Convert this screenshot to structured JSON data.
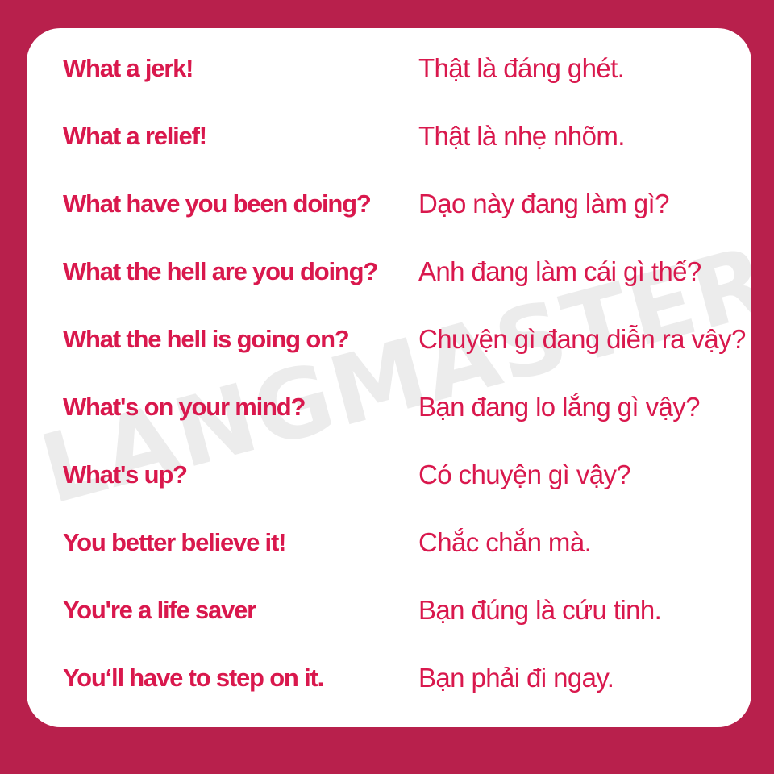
{
  "colors": {
    "frame": "#b8204c",
    "card": "#ffffff",
    "text": "#d9184d",
    "watermark": "#ececec"
  },
  "watermark": "LANGMASTER",
  "phrases": [
    {
      "en": "What a jerk!",
      "vi": "Thật là đáng ghét."
    },
    {
      "en": "What a relief!",
      "vi": "Thật là nhẹ nhõm."
    },
    {
      "en": "What have you been doing?",
      "vi": "Dạo này đang làm gì?"
    },
    {
      "en": "What the hell are you doing?",
      "vi": "Anh đang làm cái gì thế?"
    },
    {
      "en": "What the hell is going on?",
      "vi": "Chuyện gì đang diễn ra vậy?"
    },
    {
      "en": "What's on your mind?",
      "vi": "Bạn đang lo lắng gì vậy?"
    },
    {
      "en": "What's up?",
      "vi": "Có chuyện gì vậy?"
    },
    {
      "en": "You better believe it!",
      "vi": "Chắc chắn mà."
    },
    {
      "en": "You're a life saver",
      "vi": "Bạn đúng là cứu tinh."
    },
    {
      "en": "You‘ll have to step on it.",
      "vi": "Bạn phải đi ngay."
    }
  ]
}
